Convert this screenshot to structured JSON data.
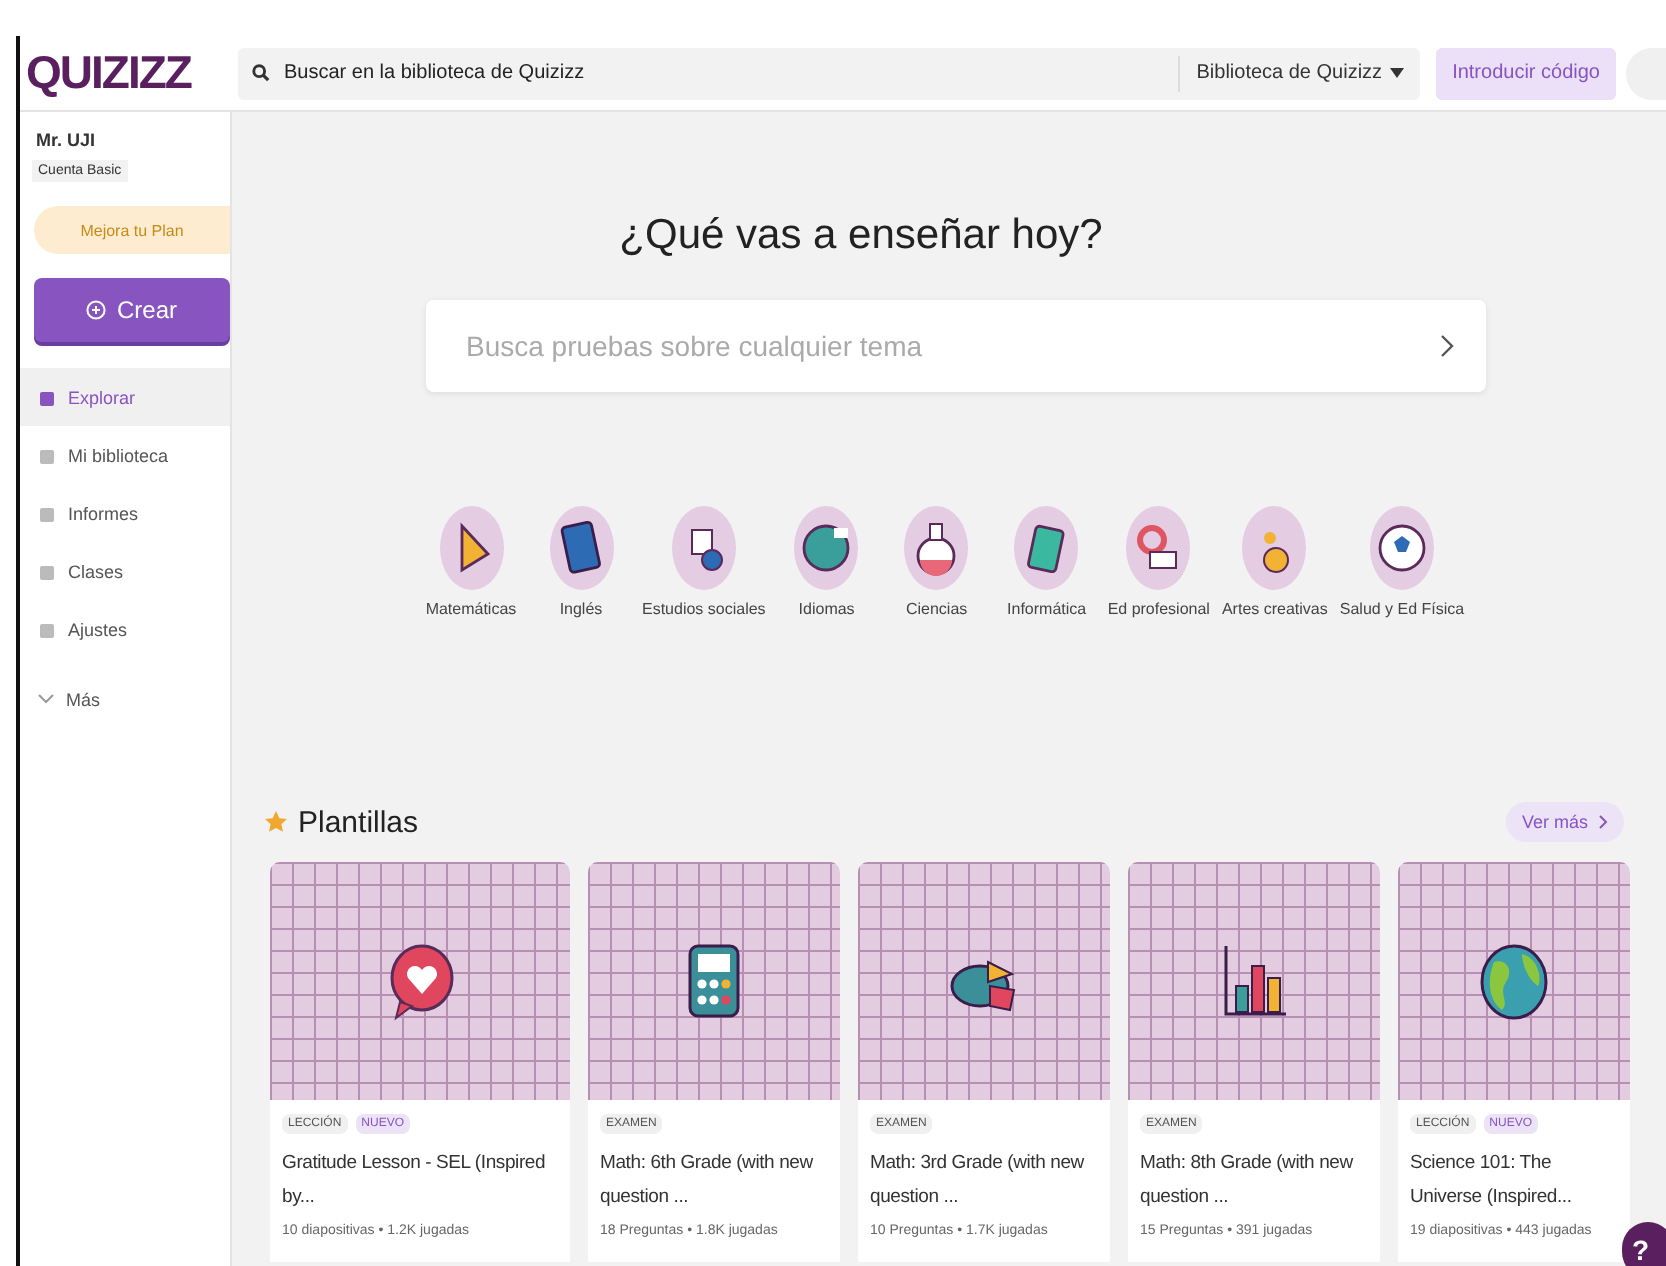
{
  "logo": "QUIZIZZ",
  "user": {
    "name": "Mr. UJI",
    "plan": "Cuenta Basic"
  },
  "upgrade_button": "Mejora tu Plan",
  "create_button": "Crear",
  "nav": [
    {
      "label": "Explorar",
      "selected": true
    },
    {
      "label": "Mi biblioteca",
      "selected": false
    },
    {
      "label": "Informes",
      "selected": false
    },
    {
      "label": "Clases",
      "selected": false
    },
    {
      "label": "Ajustes",
      "selected": false
    }
  ],
  "more": "Más",
  "header": {
    "search": {
      "placeholder": "Buscar en la biblioteca de Quizizz"
    },
    "library_dropdown": "Biblioteca de Quizizz",
    "code_button": "Introducir código"
  },
  "hero": {
    "title": "¿Qué vas a enseñar hoy?",
    "search": {
      "placeholder": "Busca pruebas sobre cualquier tema"
    }
  },
  "categories": [
    "Matemáticas",
    "Inglés",
    "Estudios sociales",
    "Idiomas",
    "Ciencias",
    "Informática",
    "Ed profesional",
    "Artes creativas",
    "Salud y Ed Física"
  ],
  "templates": {
    "title": "Plantillas",
    "more_button": "Ver más",
    "cards": [
      {
        "tags": [
          {
            "text": "LECCIÓN",
            "kind": "type"
          },
          {
            "text": "NUEVO",
            "kind": "new"
          }
        ],
        "title": "Gratitude Lesson - SEL (Inspired by...",
        "meta": "10 diapositivas • 1.2K jugadas"
      },
      {
        "tags": [
          {
            "text": "EXAMEN",
            "kind": "type"
          }
        ],
        "title": "Math: 6th Grade (with new question ...",
        "meta": "18 Preguntas • 1.8K jugadas"
      },
      {
        "tags": [
          {
            "text": "EXAMEN",
            "kind": "type"
          }
        ],
        "title": "Math: 3rd Grade (with new question ...",
        "meta": "10 Preguntas • 1.7K jugadas"
      },
      {
        "tags": [
          {
            "text": "EXAMEN",
            "kind": "type"
          }
        ],
        "title": "Math: 8th Grade (with new question ...",
        "meta": "15 Preguntas • 391 jugadas"
      },
      {
        "tags": [
          {
            "text": "LECCIÓN",
            "kind": "type"
          },
          {
            "text": "NUEVO",
            "kind": "new"
          }
        ],
        "title": "Science 101: The Universe (Inspired...",
        "meta": "19 diapositivas • 443 jugadas"
      }
    ]
  },
  "help_button": "?"
}
